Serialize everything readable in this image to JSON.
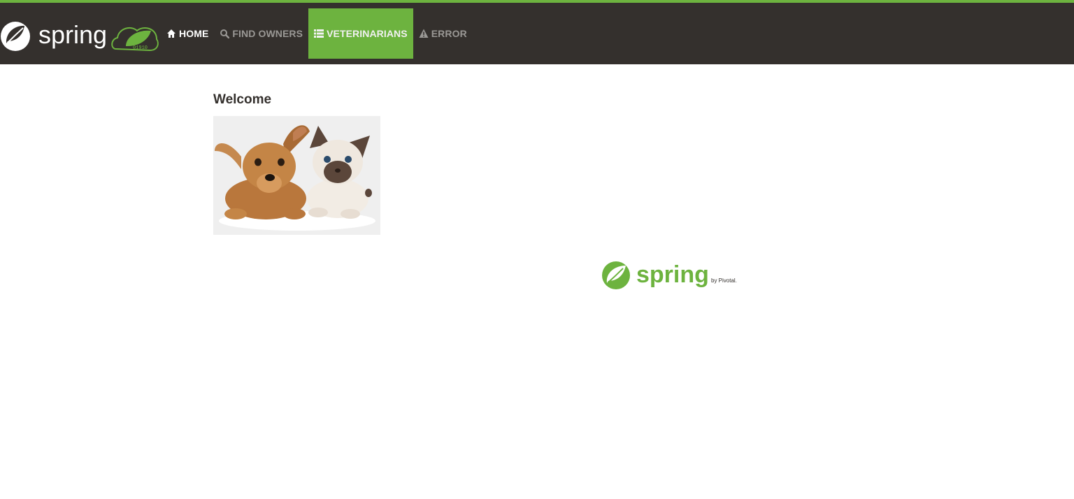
{
  "brand": {
    "wordmark": "spring"
  },
  "nav": {
    "items": [
      {
        "label": "HOME",
        "icon": "home-icon"
      },
      {
        "label": "FIND OWNERS",
        "icon": "search-icon"
      },
      {
        "label": "VETERINARIANS",
        "icon": "th-list-icon"
      },
      {
        "label": "ERROR",
        "icon": "warning-icon"
      }
    ],
    "active_item": "VETERINARIANS"
  },
  "main": {
    "heading": "Welcome"
  },
  "footer": {
    "wordmark": "spring",
    "tagline": "by Pivotal."
  },
  "colors": {
    "accent": "#6db33f",
    "navbar": "#34302d",
    "nav_text": "#9a9895",
    "heading": "#34302d"
  }
}
